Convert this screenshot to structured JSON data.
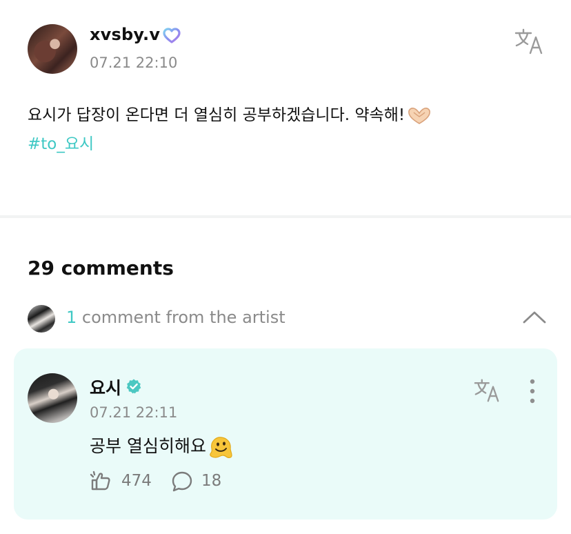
{
  "post": {
    "username": "xvsby.v",
    "date": "07.21 22:10",
    "body_text": "요시가 답장이 온다면 더 열심히 공부하겠습니다. 약속해!",
    "hashtag": "#to_요시"
  },
  "comments": {
    "count_label": "29 comments",
    "artist_count": "1",
    "artist_label": "comment from the artist"
  },
  "artist_comment": {
    "name": "요시",
    "date": "07.21 22:11",
    "text": "공부 열심히해요",
    "likes": "474",
    "replies": "18"
  },
  "icons": {
    "badge": "heart-badge-icon",
    "translate": "translate-icon",
    "verified": "verified-icon",
    "more": "more-vertical-icon",
    "like": "like-icon",
    "reply": "reply-icon",
    "chevron": "chevron-up-icon"
  },
  "colors": {
    "accent": "#3fc8c4",
    "card_bg": "#eafbf9",
    "muted": "#8a8a8a"
  }
}
